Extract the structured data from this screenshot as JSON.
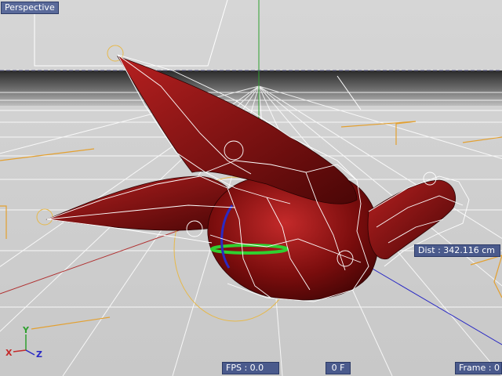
{
  "viewport": {
    "view_name": "Perspective",
    "distance_readout": "Dist : 342.116 cm",
    "fps_readout": "FPS : 0.0",
    "frame_field": "0 F",
    "frame_readout": "Frame : 0"
  },
  "axis_gizmo": {
    "x_label": "X",
    "y_label": "Y",
    "z_label": "Z"
  },
  "colors": {
    "background": "#cfcfcf",
    "grid": "#ffffff",
    "horizon_dark": "#3a3a3a",
    "model_fill": "#7a0d0d",
    "model_highlight": "#c42a2a",
    "cage_wire": "#ffffff",
    "selection_circle": "#e6b84a",
    "y_axis": "#2ea02e",
    "x_axis": "#c42a2a",
    "z_axis": "#2a2ac4",
    "hud_bg": "#4a5a8c"
  }
}
